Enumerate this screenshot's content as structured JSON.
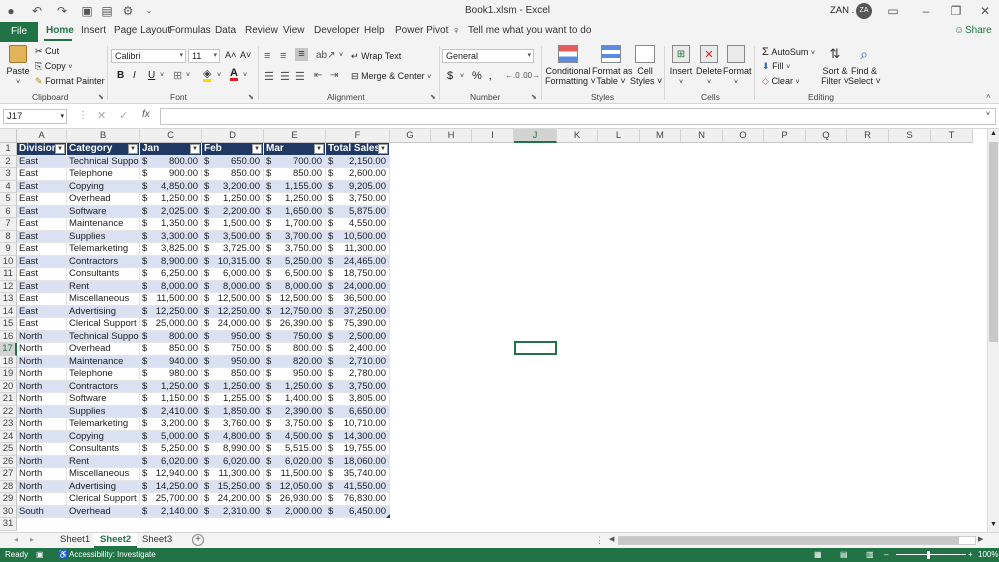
{
  "window": {
    "title": "Book1.xlsm - Excel",
    "user": "ZAN .",
    "avatar_initials": "ZA",
    "share_label": "Share"
  },
  "tabs": [
    "File",
    "Home",
    "Insert",
    "Page Layout",
    "Formulas",
    "Data",
    "Review",
    "View",
    "Developer",
    "Help",
    "Power Pivot"
  ],
  "active_tab": "Home",
  "tell_me": "Tell me what you want to do",
  "clipboard": {
    "paste": "Paste",
    "cut": "Cut",
    "copy": "Copy",
    "format_painter": "Format Painter",
    "label": "Clipboard"
  },
  "font": {
    "name": "Calibri",
    "size": "11",
    "bold": "B",
    "italic": "I",
    "underline": "U",
    "grow": "A˄",
    "shrink": "A˅",
    "label": "Font"
  },
  "alignment": {
    "wrap_text": "Wrap Text",
    "merge_center": "Merge & Center",
    "label": "Alignment"
  },
  "number": {
    "format": "General",
    "currency": "$",
    "percent": "%",
    "comma": "‚",
    "label": "Number"
  },
  "styles": {
    "conditional": [
      "Conditional",
      "Formatting ˅"
    ],
    "format_table": [
      "Format as",
      "Table ˅"
    ],
    "cell_styles": [
      "Cell",
      "Styles ˅"
    ],
    "label": "Styles"
  },
  "cells": {
    "insert": "Insert",
    "delete": "Delete",
    "format": "Format",
    "label": "Cells"
  },
  "editing": {
    "autosum": "AutoSum",
    "fill": "Fill",
    "clear": "Clear",
    "sort_filter": [
      "Sort &",
      "Filter ˅"
    ],
    "find_select": [
      "Find &",
      "Select ˅"
    ],
    "label": "Editing"
  },
  "formula_bar": {
    "name_box": "J17",
    "fx": "fx",
    "content": ""
  },
  "columns": [
    "A",
    "B",
    "C",
    "D",
    "E",
    "F",
    "G",
    "H",
    "I",
    "J",
    "K",
    "L",
    "M",
    "N",
    "O",
    "P",
    "Q",
    "R",
    "S",
    "T"
  ],
  "table_headers": [
    "Division",
    "Category",
    "Jan",
    "Feb",
    "Mar",
    "Total Sales"
  ],
  "rows": [
    [
      "East",
      "Technical Support",
      "800.00",
      "650.00",
      "700.00",
      "2,150.00"
    ],
    [
      "East",
      "Telephone",
      "900.00",
      "850.00",
      "850.00",
      "2,600.00"
    ],
    [
      "East",
      "Copying",
      "4,850.00",
      "3,200.00",
      "1,155.00",
      "9,205.00"
    ],
    [
      "East",
      "Overhead",
      "1,250.00",
      "1,250.00",
      "1,250.00",
      "3,750.00"
    ],
    [
      "East",
      "Software",
      "2,025.00",
      "2,200.00",
      "1,650.00",
      "5,875.00"
    ],
    [
      "East",
      "Maintenance",
      "1,350.00",
      "1,500.00",
      "1,700.00",
      "4,550.00"
    ],
    [
      "East",
      "Supplies",
      "3,300.00",
      "3,500.00",
      "3,700.00",
      "10,500.00"
    ],
    [
      "East",
      "Telemarketing",
      "3,825.00",
      "3,725.00",
      "3,750.00",
      "11,300.00"
    ],
    [
      "East",
      "Contractors",
      "8,900.00",
      "10,315.00",
      "5,250.00",
      "24,465.00"
    ],
    [
      "East",
      "Consultants",
      "6,250.00",
      "6,000.00",
      "6,500.00",
      "18,750.00"
    ],
    [
      "East",
      "Rent",
      "8,000.00",
      "8,000.00",
      "8,000.00",
      "24,000.00"
    ],
    [
      "East",
      "Miscellaneous",
      "11,500.00",
      "12,500.00",
      "12,500.00",
      "36,500.00"
    ],
    [
      "East",
      "Advertising",
      "12,250.00",
      "12,250.00",
      "12,750.00",
      "37,250.00"
    ],
    [
      "East",
      "Clerical Support",
      "25,000.00",
      "24,000.00",
      "26,390.00",
      "75,390.00"
    ],
    [
      "North",
      "Technical Support",
      "800.00",
      "950.00",
      "750.00",
      "2,500.00"
    ],
    [
      "North",
      "Overhead",
      "850.00",
      "750.00",
      "800.00",
      "2,400.00"
    ],
    [
      "North",
      "Maintenance",
      "940.00",
      "950.00",
      "820.00",
      "2,710.00"
    ],
    [
      "North",
      "Telephone",
      "980.00",
      "850.00",
      "950.00",
      "2,780.00"
    ],
    [
      "North",
      "Contractors",
      "1,250.00",
      "1,250.00",
      "1,250.00",
      "3,750.00"
    ],
    [
      "North",
      "Software",
      "1,150.00",
      "1,255.00",
      "1,400.00",
      "3,805.00"
    ],
    [
      "North",
      "Supplies",
      "2,410.00",
      "1,850.00",
      "2,390.00",
      "6,650.00"
    ],
    [
      "North",
      "Telemarketing",
      "3,200.00",
      "3,760.00",
      "3,750.00",
      "10,710.00"
    ],
    [
      "North",
      "Copying",
      "5,000.00",
      "4,800.00",
      "4,500.00",
      "14,300.00"
    ],
    [
      "North",
      "Consultants",
      "5,250.00",
      "8,990.00",
      "5,515.00",
      "19,755.00"
    ],
    [
      "North",
      "Rent",
      "6,020.00",
      "6,020.00",
      "6,020.00",
      "18,060.00"
    ],
    [
      "North",
      "Miscellaneous",
      "12,940.00",
      "11,300.00",
      "11,500.00",
      "35,740.00"
    ],
    [
      "North",
      "Advertising",
      "14,250.00",
      "15,250.00",
      "12,050.00",
      "41,550.00"
    ],
    [
      "North",
      "Clerical Support",
      "25,700.00",
      "24,200.00",
      "26,930.00",
      "76,830.00"
    ],
    [
      "South",
      "Overhead",
      "2,140.00",
      "2,310.00",
      "2,000.00",
      "6,450.00"
    ]
  ],
  "currency_symbol": "$",
  "sheets": [
    "Sheet1",
    "Sheet2",
    "Sheet3"
  ],
  "active_sheet": "Sheet2",
  "status": {
    "ready": "Ready",
    "accessibility": "Accessibility: Investigate",
    "zoom": "100%"
  },
  "colors": {
    "excel_green": "#217346",
    "table_header": "#1f3864",
    "band": "#d9e1f2"
  }
}
